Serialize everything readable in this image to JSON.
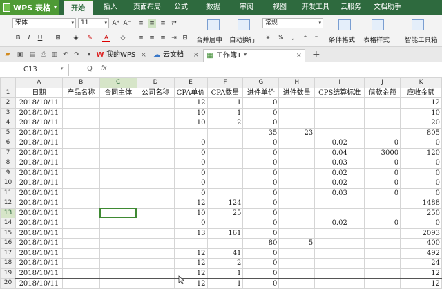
{
  "app": {
    "name": "WPS 表格"
  },
  "menu": [
    "开始",
    "插入",
    "页面布局",
    "公式",
    "数据",
    "审阅",
    "视图",
    "开发工具",
    "云服务",
    "文档助手"
  ],
  "ribbon": {
    "font_name": "宋体",
    "font_size": "11",
    "bold": "B",
    "italic": "I",
    "underline": "U",
    "font_color": "A",
    "grow": "A⁺",
    "shrink": "A⁻",
    "merge_center": "合并居中",
    "wrap": "自动换行",
    "number_format": "常规",
    "cond_format": "条件格式",
    "table_style": "表格样式",
    "smart_tool": "智能工具箱"
  },
  "tabs": [
    {
      "label": "我的WPS",
      "icon": "W"
    },
    {
      "label": "云文档",
      "icon": "☁"
    },
    {
      "label": "工作簿1 *",
      "icon": "▦"
    }
  ],
  "formula_bar": {
    "cell_ref": "C13",
    "fx": "fx",
    "zoom": "Q"
  },
  "columns": [
    "A",
    "B",
    "C",
    "D",
    "E",
    "F",
    "G",
    "H",
    "I",
    "J",
    "K"
  ],
  "rows": [
    [
      "1",
      "日期",
      "产品名称",
      "合同主体",
      "公司名称",
      "CPA单价",
      "CPA数量",
      "进件单价",
      "进件数量",
      "CPS结算标准",
      "借款金额",
      "应收金额"
    ],
    [
      "2",
      "2018/10/11",
      "",
      "",
      "",
      "12",
      "1",
      "0",
      "",
      "",
      "",
      "12"
    ],
    [
      "3",
      "2018/10/11",
      "",
      "",
      "",
      "10",
      "1",
      "0",
      "",
      "",
      "",
      "10"
    ],
    [
      "4",
      "2018/10/11",
      "",
      "",
      "",
      "10",
      "2",
      "0",
      "",
      "",
      "",
      "20"
    ],
    [
      "5",
      "2018/10/11",
      "",
      "",
      "",
      "",
      "",
      "35",
      "23",
      "",
      "",
      "805"
    ],
    [
      "6",
      "2018/10/11",
      "",
      "",
      "",
      "0",
      "",
      "0",
      "",
      "0.02",
      "0",
      "0"
    ],
    [
      "7",
      "2018/10/11",
      "",
      "",
      "",
      "0",
      "",
      "0",
      "",
      "0.04",
      "3000",
      "120"
    ],
    [
      "8",
      "2018/10/11",
      "",
      "",
      "",
      "0",
      "",
      "0",
      "",
      "0.03",
      "0",
      "0"
    ],
    [
      "9",
      "2018/10/11",
      "",
      "",
      "",
      "0",
      "",
      "0",
      "",
      "0.02",
      "0",
      "0"
    ],
    [
      "10",
      "2018/10/11",
      "",
      "",
      "",
      "0",
      "",
      "0",
      "",
      "0.02",
      "0",
      "0"
    ],
    [
      "11",
      "2018/10/11",
      "",
      "",
      "",
      "0",
      "",
      "0",
      "",
      "0.03",
      "0",
      "0"
    ],
    [
      "12",
      "2018/10/11",
      "",
      "",
      "",
      "12",
      "124",
      "0",
      "",
      "",
      "",
      "1488"
    ],
    [
      "13",
      "2018/10/11",
      "",
      "",
      "",
      "10",
      "25",
      "0",
      "",
      "",
      "",
      "250"
    ],
    [
      "14",
      "2018/10/11",
      "",
      "",
      "",
      "0",
      "",
      "0",
      "",
      "0.02",
      "0",
      "0"
    ],
    [
      "15",
      "2018/10/11",
      "",
      "",
      "",
      "13",
      "161",
      "0",
      "",
      "",
      "",
      "2093"
    ],
    [
      "16",
      "2018/10/11",
      "",
      "",
      "",
      "",
      "",
      "80",
      "5",
      "",
      "",
      "400"
    ],
    [
      "17",
      "2018/10/11",
      "",
      "",
      "",
      "12",
      "41",
      "0",
      "",
      "",
      "",
      "492"
    ],
    [
      "18",
      "2018/10/11",
      "",
      "",
      "",
      "12",
      "2",
      "0",
      "",
      "",
      "",
      "24"
    ],
    [
      "19",
      "2018/10/11",
      "",
      "",
      "",
      "12",
      "1",
      "0",
      "",
      "",
      "",
      "12"
    ],
    [
      "20",
      "2018/10/11",
      "",
      "",
      "",
      "12",
      "1",
      "0",
      "",
      "",
      "",
      "12"
    ]
  ]
}
